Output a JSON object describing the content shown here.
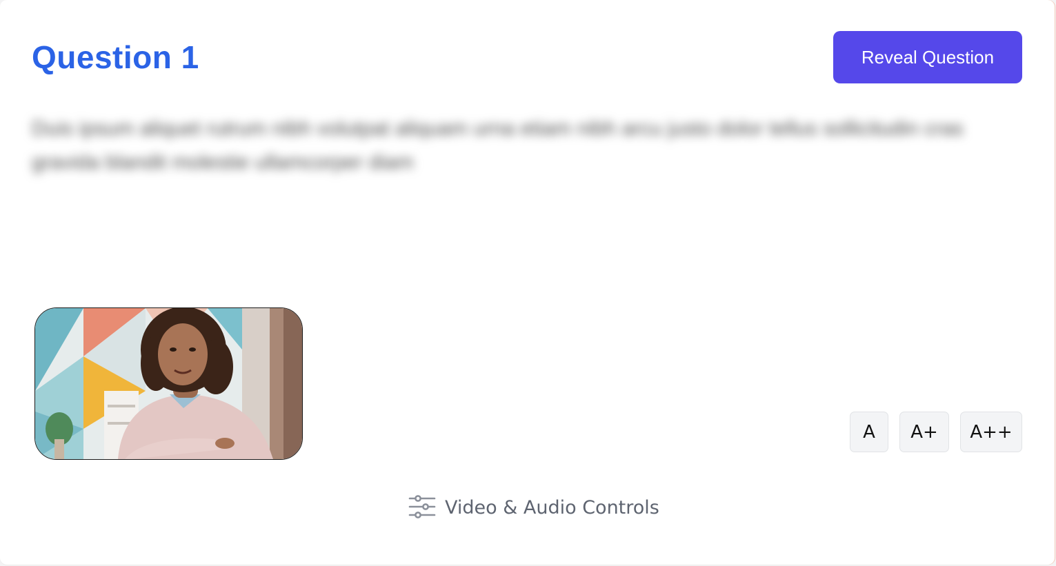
{
  "question": {
    "title": "Question 1",
    "reveal_label": "Reveal Question",
    "hidden_text": "Duis ipsum aliquet rutrum nibh volutpat aliquam urna etiam nibh arcu justo dolor tellus sollicitudin cras gravida blandit molestie ullamcorper diam"
  },
  "video": {
    "description": "participant camera preview"
  },
  "font_size_controls": [
    {
      "label": "A"
    },
    {
      "label": "A+"
    },
    {
      "label": "A++"
    }
  ],
  "footer": {
    "controls_label": "Video & Audio Controls",
    "controls_icon": "sliders-icon"
  },
  "colors": {
    "title": "#2b63e6",
    "primary_button": "#5548ea",
    "muted_text": "#5e6470"
  }
}
